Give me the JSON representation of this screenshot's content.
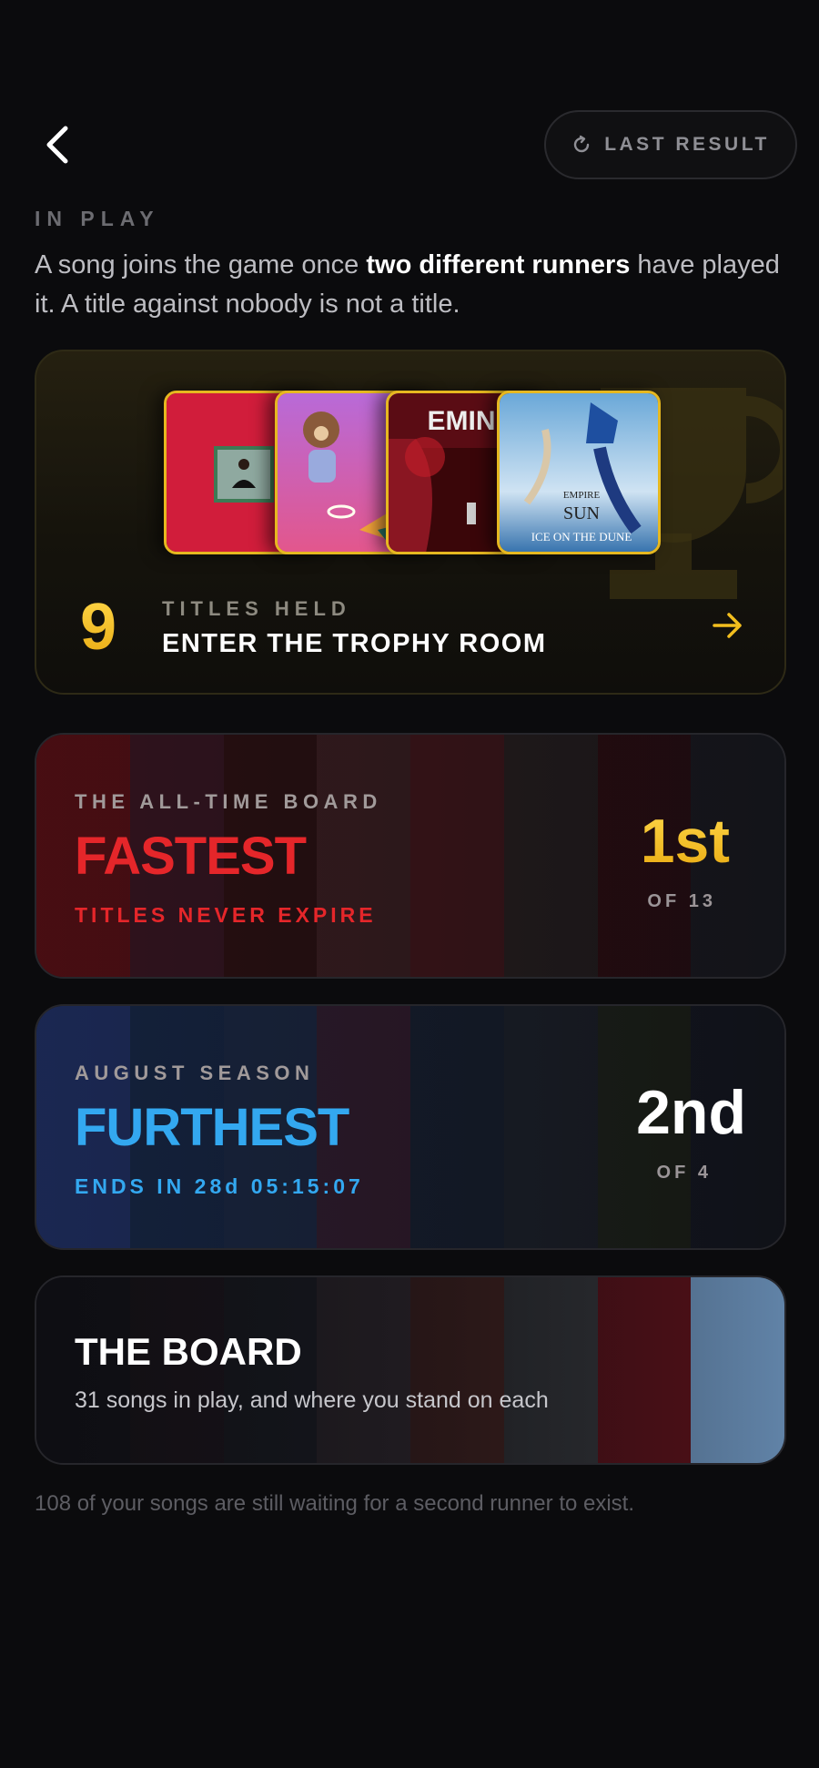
{
  "header": {
    "last_result_label": "LAST RESULT"
  },
  "section": {
    "label": "IN PLAY",
    "intro_prefix": "A song joins the game once ",
    "intro_bold": "two different runners",
    "intro_suffix": " have played it. A title against nobody is not a title."
  },
  "trophy": {
    "count": "9",
    "label": "TITLES HELD",
    "cta": "ENTER THE TROPHY ROOM",
    "covers": [
      {
        "name": "red-album-cover",
        "text": ""
      },
      {
        "name": "graduation-album-cover",
        "text": ""
      },
      {
        "name": "eminem-album-cover",
        "text": "EMINE"
      },
      {
        "name": "empire-of-the-sun-cover",
        "text": "ICE ON THE DUNE"
      }
    ]
  },
  "boards": [
    {
      "eyebrow": "THE ALL-TIME BOARD",
      "headline": "FASTEST",
      "sub": "TITLES NEVER EXPIRE",
      "rank": "1st",
      "of": "OF 13",
      "accent": "#e5262a"
    },
    {
      "eyebrow": "AUGUST SEASON",
      "headline": "FURTHEST",
      "sub": "ENDS IN 28d 05:15:07",
      "rank": "2nd",
      "of": "OF 4",
      "accent": "#33a8f0"
    }
  ],
  "the_board": {
    "title": "THE BOARD",
    "subtitle": "31 songs in play, and where you stand on each"
  },
  "footnote": "108 of your songs are still waiting for a second runner to exist.",
  "colors": {
    "gold": "#f2be1e",
    "red": "#e5262a",
    "blue": "#33a8f0",
    "background": "#0b0b0d"
  }
}
